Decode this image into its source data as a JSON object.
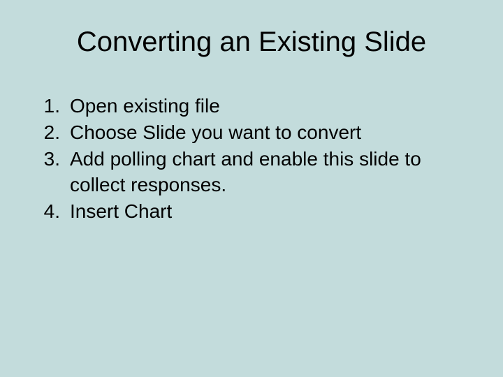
{
  "title": "Converting an Existing Slide",
  "items": [
    {
      "num": "1.",
      "text": "Open existing file"
    },
    {
      "num": "2.",
      "text": "Choose Slide you want to convert"
    },
    {
      "num": "3.",
      "text": "Add polling chart and enable this slide to collect responses."
    },
    {
      "num": "4.",
      "text": "Insert Chart"
    }
  ]
}
